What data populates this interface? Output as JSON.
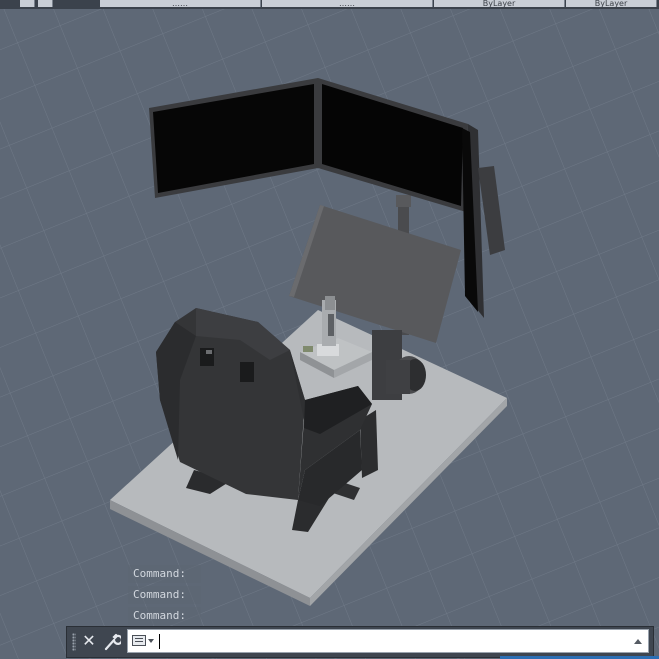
{
  "top_toolbar": {
    "fields": [
      {
        "id": "layer-state",
        "label": "……"
      },
      {
        "id": "color",
        "label": "……"
      },
      {
        "id": "linetype",
        "label": "ByLayer"
      },
      {
        "id": "lineweight",
        "label": "ByLayer"
      },
      {
        "id": "plot-style",
        "label": ""
      }
    ]
  },
  "command_history": [
    "Command:",
    "Command:",
    "Command:"
  ],
  "command_line": {
    "value": "",
    "close_icon": "close-icon",
    "customize_icon": "wrench-icon",
    "prompt_icon": "command-prompt-icon",
    "history_icon": "chevron-up-icon"
  },
  "scene": {
    "description_icon": "3d-model-viewport",
    "colors": {
      "background": "#5f6977",
      "grid": "#6d7785",
      "floor_plate": "#b9bcbf",
      "monitor": "#050505",
      "frame": "#3b3b3d",
      "seat": "#2e2f31"
    }
  }
}
